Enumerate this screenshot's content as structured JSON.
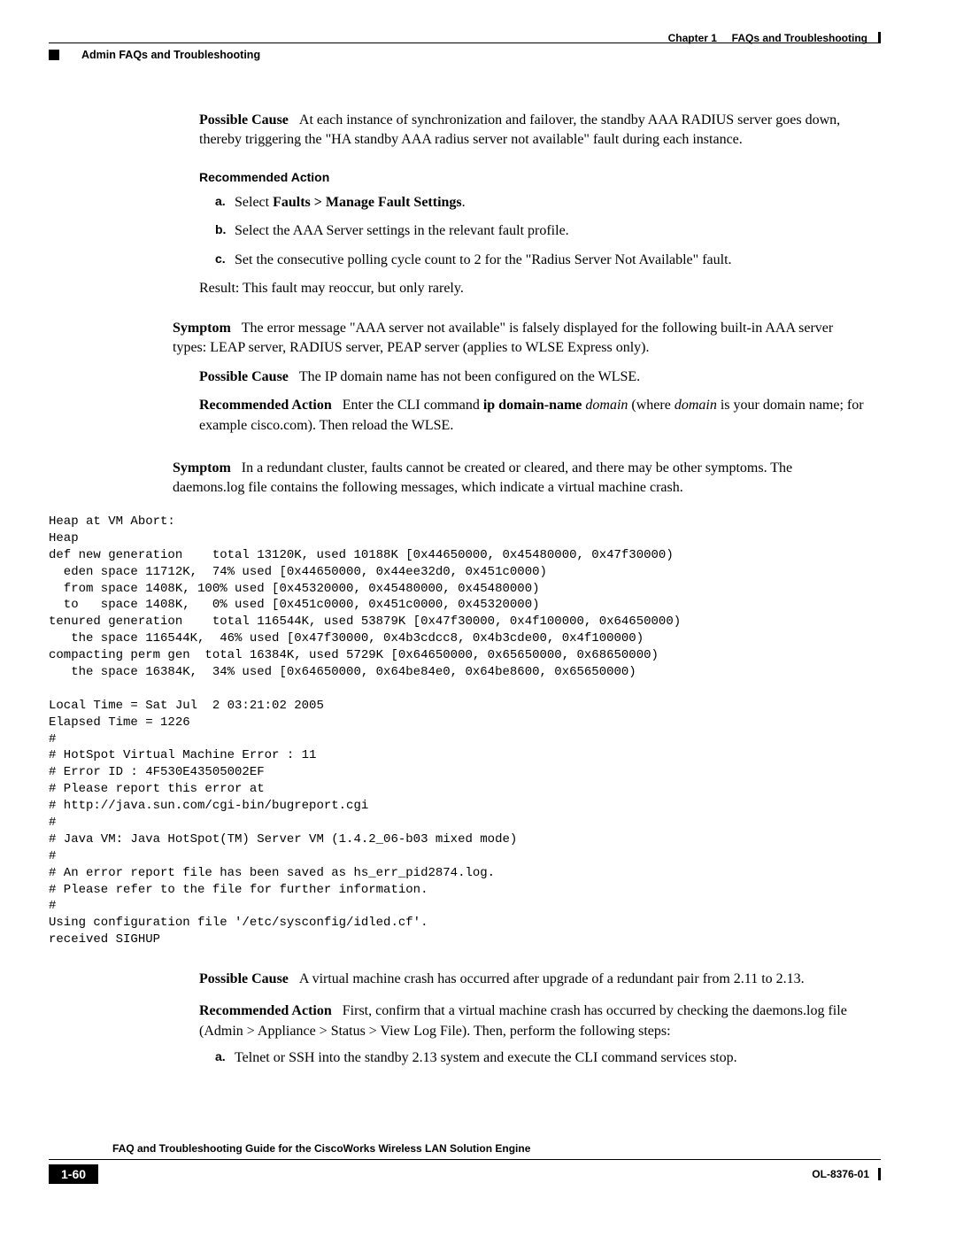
{
  "header": {
    "chapter_label": "Chapter 1",
    "chapter_title": "FAQs and Troubleshooting",
    "page_section": "Admin FAQs and Troubleshooting"
  },
  "block1": {
    "possible_cause_label": "Possible Cause",
    "possible_cause_text": "At each instance of synchronization and failover, the standby AAA RADIUS server goes down, thereby triggering the \"HA standby AAA radius server not available\" fault during each instance.",
    "recommended_action_label": "Recommended Action",
    "steps": [
      {
        "letter": "a.",
        "prefix": "Select ",
        "bold": "Faults > Manage Fault Settings",
        "suffix": "."
      },
      {
        "letter": "b.",
        "text": "Select the AAA Server settings in the relevant fault profile."
      },
      {
        "letter": "c.",
        "text": "Set the consecutive polling cycle count to 2 for the \"Radius Server Not Available\" fault."
      }
    ],
    "result_text": "Result: This fault may reoccur, but only rarely."
  },
  "block2": {
    "symptom_label": "Symptom",
    "symptom_text": "The error message \"AAA server not available\" is falsely displayed for the following built-in AAA server types: LEAP server, RADIUS server, PEAP server (applies to WLSE Express only).",
    "possible_cause_label": "Possible Cause",
    "possible_cause_text": "The IP domain name has not been configured on the WLSE.",
    "recommended_action_label": "Recommended Action",
    "recommended_action_pre": "Enter the CLI command ",
    "recommended_action_cmd_bold": "ip domain-name ",
    "recommended_action_cmd_italic": "domain",
    "recommended_action_mid": " (where ",
    "recommended_action_domain_italic": "domain",
    "recommended_action_post": " is your domain name; for example cisco.com). Then reload the WLSE."
  },
  "block3": {
    "symptom_label": "Symptom",
    "symptom_text": "In a redundant cluster, faults cannot be created or cleared, and there may be other symptoms. The daemons.log file contains the following messages, which indicate a virtual machine crash.",
    "code": "Heap at VM Abort:\nHeap\ndef new generation    total 13120K, used 10188K [0x44650000, 0x45480000, 0x47f30000)\n  eden space 11712K,  74% used [0x44650000, 0x44ee32d0, 0x451c0000)\n  from space 1408K, 100% used [0x45320000, 0x45480000, 0x45480000)\n  to   space 1408K,   0% used [0x451c0000, 0x451c0000, 0x45320000)\ntenured generation    total 116544K, used 53879K [0x47f30000, 0x4f100000, 0x64650000)\n   the space 116544K,  46% used [0x47f30000, 0x4b3cdcc8, 0x4b3cde00, 0x4f100000)\ncompacting perm gen  total 16384K, used 5729K [0x64650000, 0x65650000, 0x68650000)\n   the space 16384K,  34% used [0x64650000, 0x64be84e0, 0x64be8600, 0x65650000)\n\nLocal Time = Sat Jul  2 03:21:02 2005\nElapsed Time = 1226\n#\n# HotSpot Virtual Machine Error : 11\n# Error ID : 4F530E43505002EF\n# Please report this error at\n# http://java.sun.com/cgi-bin/bugreport.cgi\n#\n# Java VM: Java HotSpot(TM) Server VM (1.4.2_06-b03 mixed mode)\n#\n# An error report file has been saved as hs_err_pid2874.log.\n# Please refer to the file for further information.\n#\nUsing configuration file '/etc/sysconfig/idled.cf'.\nreceived SIGHUP",
    "possible_cause_label": "Possible Cause",
    "possible_cause_text": "A virtual machine crash has occurred after upgrade of a redundant pair from 2.11 to 2.13.",
    "recommended_action_label": "Recommended Action",
    "recommended_action_text": "First, confirm that a virtual machine crash has occurred by checking the daemons.log file (Admin > Appliance > Status > View Log File). Then, perform the following steps:",
    "steps": [
      {
        "letter": "a.",
        "text": "Telnet or SSH into the standby 2.13 system and execute the CLI command services stop."
      }
    ]
  },
  "footer": {
    "doc_title": "FAQ and Troubleshooting Guide for the CiscoWorks Wireless LAN Solution Engine",
    "page_number": "1-60",
    "doc_id": "OL-8376-01"
  }
}
